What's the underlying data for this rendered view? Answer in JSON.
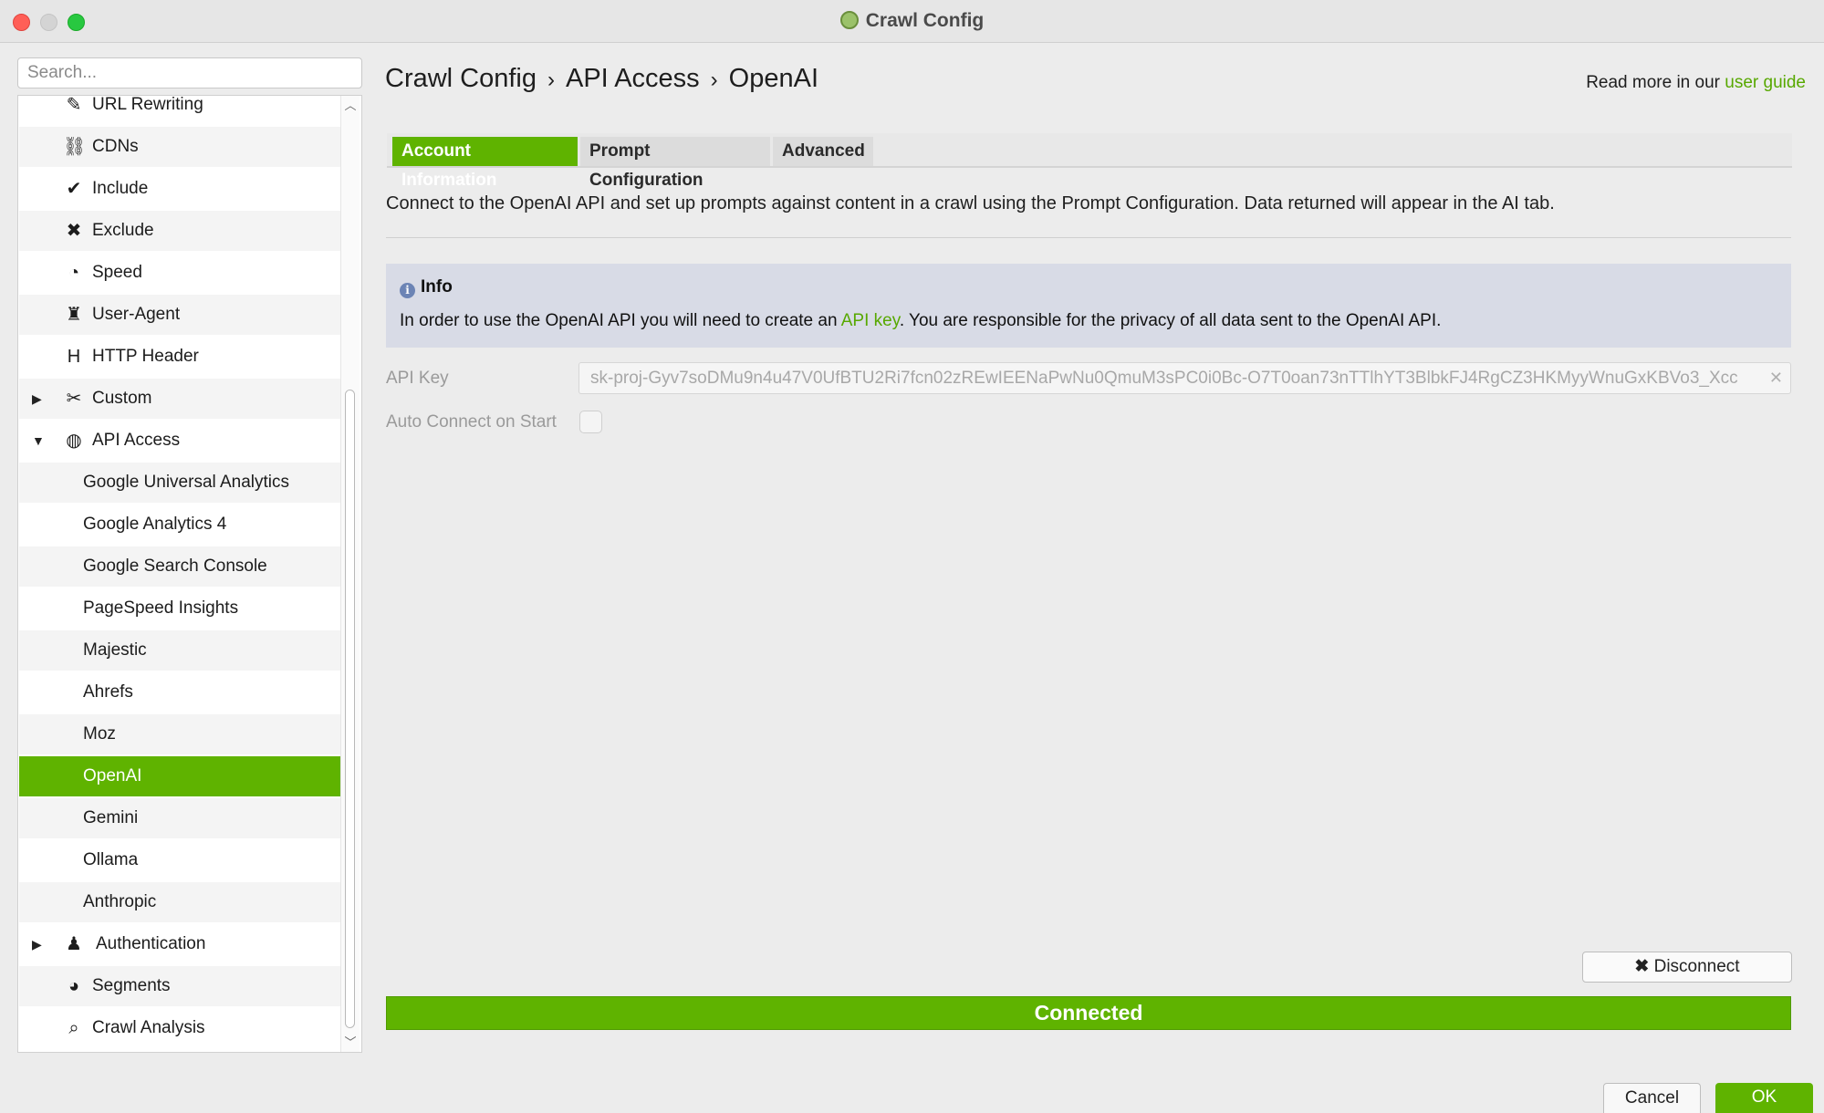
{
  "window": {
    "title": "Crawl Config"
  },
  "search": {
    "placeholder": "Search..."
  },
  "sidebar": {
    "items": [
      {
        "label": "URL Rewriting",
        "icon": "edit-icon"
      },
      {
        "label": "CDNs",
        "icon": "network-icon"
      },
      {
        "label": "Include",
        "icon": "check-circle-icon"
      },
      {
        "label": "Exclude",
        "icon": "x-circle-icon"
      },
      {
        "label": "Speed",
        "icon": "speedometer-icon"
      },
      {
        "label": "User-Agent",
        "icon": "user-secret-icon"
      },
      {
        "label": "HTTP Header",
        "icon": "heading-icon"
      },
      {
        "label": "Custom",
        "icon": "tools-icon",
        "expandable": true,
        "expanded": false
      },
      {
        "label": "API Access",
        "icon": "globe-icon",
        "expandable": true,
        "expanded": true
      },
      {
        "label": "Google Universal Analytics",
        "child": true
      },
      {
        "label": "Google Analytics 4",
        "child": true
      },
      {
        "label": "Google Search Console",
        "child": true
      },
      {
        "label": "PageSpeed Insights",
        "child": true
      },
      {
        "label": "Majestic",
        "child": true
      },
      {
        "label": "Ahrefs",
        "child": true
      },
      {
        "label": "Moz",
        "child": true
      },
      {
        "label": "OpenAI",
        "child": true,
        "selected": true
      },
      {
        "label": "Gemini",
        "child": true
      },
      {
        "label": "Ollama",
        "child": true
      },
      {
        "label": "Anthropic",
        "child": true
      },
      {
        "label": "Authentication",
        "icon": "user-lock-icon",
        "expandable": true,
        "expanded": false
      },
      {
        "label": "Segments",
        "icon": "pie-chart-icon"
      },
      {
        "label": "Crawl Analysis",
        "icon": "search-icon"
      }
    ]
  },
  "breadcrumb": [
    "Crawl Config",
    "API Access",
    "OpenAI"
  ],
  "breadcrumb_separator": "›",
  "readmore": {
    "prefix": "Read more in our ",
    "link": "user guide"
  },
  "tabs": [
    {
      "label": "Account Information",
      "active": true
    },
    {
      "label": "Prompt Configuration",
      "active": false
    },
    {
      "label": "Advanced",
      "active": false
    }
  ],
  "description": "Connect to the OpenAI API and set up prompts against content in a crawl using the Prompt Configuration. Data returned will appear in the AI tab.",
  "info": {
    "title": "Info",
    "text_before": "In order to use the OpenAI API you will need to create an ",
    "link": "API key",
    "text_after": ". You are responsible for the privacy of all data sent to the OpenAI API."
  },
  "form": {
    "api_key_label": "API Key",
    "api_key_value": "sk-proj-Gyv7soDMu9n4u47V0UfBTU2Ri7fcn02zREwIEENaPwNu0QmuM3sPC0i0Bc-O7T0oan73nTTlhYT3BlbkFJ4RgCZ3HKMyyWnuGxKBVo3_Xcc",
    "auto_connect_label": "Auto Connect on Start",
    "auto_connect_checked": false
  },
  "buttons": {
    "disconnect": "Disconnect",
    "connected": "Connected",
    "cancel": "Cancel",
    "ok": "OK"
  },
  "colors": {
    "accent": "#5fb300",
    "link": "#57a800",
    "info_bg": "#d8dbe6"
  }
}
